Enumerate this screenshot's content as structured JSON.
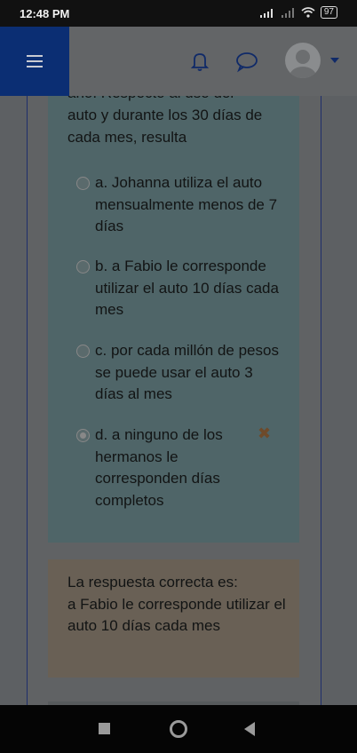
{
  "status": {
    "time": "12:48 PM",
    "battery": "97"
  },
  "header": {
    "menu_icon": "hamburger-icon",
    "notifications_icon": "bell-icon",
    "messages_icon": "chat-icon",
    "user_icon": "avatar",
    "user_menu_icon": "caret-down-icon"
  },
  "question": {
    "text_cut": "año. Respecto al uso del",
    "text_line1": "auto y durante los 30 días de",
    "text_line2": "cada mes, resulta",
    "options": [
      {
        "letter": "a.",
        "text": "Johanna utiliza el auto mensualmente menos de 7 días",
        "selected": false
      },
      {
        "letter": "b.",
        "text": "a Fabio le corresponde utilizar el auto 10 días cada mes",
        "selected": false
      },
      {
        "letter": "c.",
        "text": "por cada millón de pesos se puede usar el auto 3 días al mes",
        "selected": false
      },
      {
        "letter": "d.",
        "text": "a ninguno de los hermanos le corresponden días completos",
        "selected": true
      }
    ],
    "incorrect_mark": "✖"
  },
  "feedback": {
    "label": "La respuesta correcta es:",
    "answer": "a Fabio le corresponde utilizar el auto 10 días cada mes"
  },
  "navbar": {
    "recent": "square-icon",
    "home": "circle-icon",
    "back": "triangle-back-icon"
  }
}
